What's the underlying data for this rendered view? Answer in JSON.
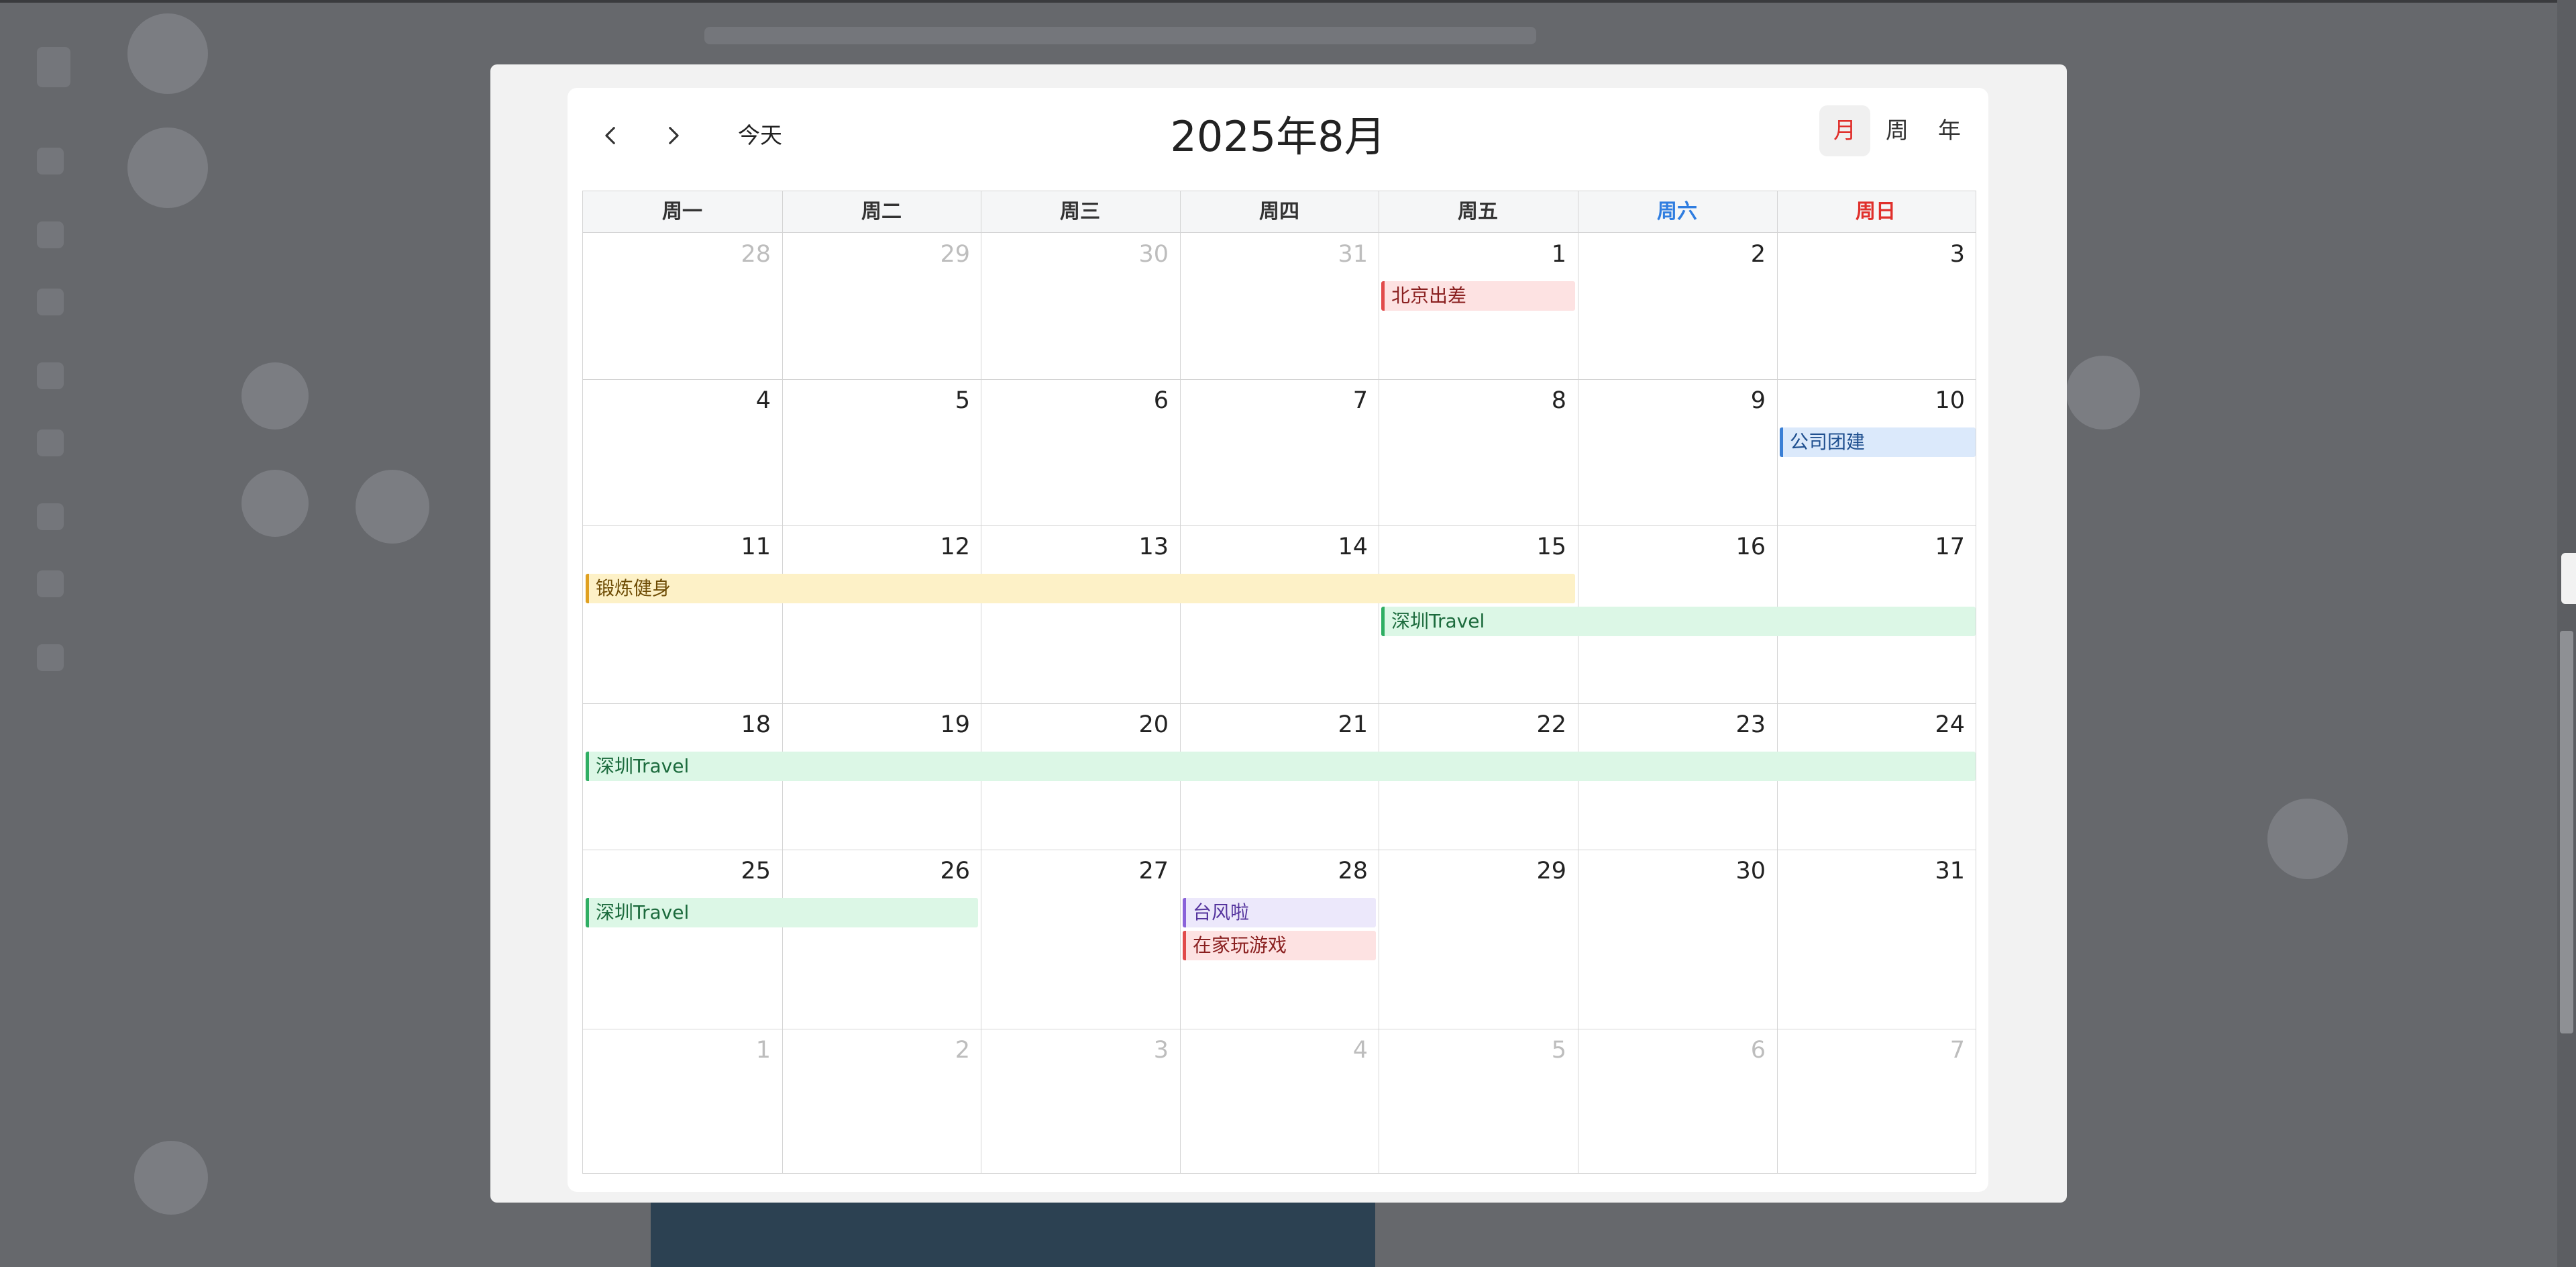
{
  "header": {
    "today_label": "今天",
    "title": "2025年8月",
    "views": [
      "月",
      "周",
      "年"
    ],
    "active_view": "月"
  },
  "weekdays": [
    "周一",
    "周二",
    "周三",
    "周四",
    "周五",
    "周六",
    "周日"
  ],
  "weeks": [
    [
      {
        "d": "28",
        "other": true
      },
      {
        "d": "29",
        "other": true
      },
      {
        "d": "30",
        "other": true
      },
      {
        "d": "31",
        "other": true
      },
      {
        "d": "1"
      },
      {
        "d": "2"
      },
      {
        "d": "3"
      }
    ],
    [
      {
        "d": "4"
      },
      {
        "d": "5"
      },
      {
        "d": "6"
      },
      {
        "d": "7"
      },
      {
        "d": "8"
      },
      {
        "d": "9"
      },
      {
        "d": "10"
      }
    ],
    [
      {
        "d": "11"
      },
      {
        "d": "12"
      },
      {
        "d": "13"
      },
      {
        "d": "14"
      },
      {
        "d": "15"
      },
      {
        "d": "16"
      },
      {
        "d": "17"
      }
    ],
    [
      {
        "d": "18"
      },
      {
        "d": "19"
      },
      {
        "d": "20"
      },
      {
        "d": "21"
      },
      {
        "d": "22"
      },
      {
        "d": "23"
      },
      {
        "d": "24"
      }
    ],
    [
      {
        "d": "25"
      },
      {
        "d": "26"
      },
      {
        "d": "27"
      },
      {
        "d": "28"
      },
      {
        "d": "29"
      },
      {
        "d": "30"
      },
      {
        "d": "31"
      }
    ],
    [
      {
        "d": "1",
        "other": true
      },
      {
        "d": "2",
        "other": true
      },
      {
        "d": "3",
        "other": true
      },
      {
        "d": "4",
        "other": true
      },
      {
        "d": "5",
        "other": true
      },
      {
        "d": "6",
        "other": true
      },
      {
        "d": "7",
        "other": true
      }
    ]
  ],
  "events": [
    {
      "title": "北京出差",
      "start": "2025-08-01",
      "end": "2025-08-01",
      "color": "red"
    },
    {
      "title": "公司团建",
      "start": "2025-08-10",
      "end": "2025-08-10",
      "color": "blue"
    },
    {
      "title": "锻炼健身",
      "start": "2025-08-11",
      "end": "2025-08-15",
      "color": "yellow"
    },
    {
      "title": "深圳Travel",
      "start": "2025-08-15",
      "end": "2025-08-26",
      "color": "green"
    },
    {
      "title": "台风啦",
      "start": "2025-08-28",
      "end": "2025-08-28",
      "color": "purple"
    },
    {
      "title": "在家玩游戏",
      "start": "2025-08-28",
      "end": "2025-08-28",
      "color": "red"
    }
  ],
  "colors": {
    "weekday_sat": "#2f7de0",
    "weekday_sun": "#e0302c",
    "active_view": "#e0302c",
    "event_palette": {
      "red": {
        "bg": "#fde2e2",
        "border": "#e14b4b",
        "text": "#8a2020"
      },
      "blue": {
        "bg": "#dbe9fb",
        "border": "#3a7fd5",
        "text": "#1f4f8f"
      },
      "yellow": {
        "bg": "#fdf1c7",
        "border": "#e0a020",
        "text": "#6e4c05"
      },
      "green": {
        "bg": "#dcf7e6",
        "border": "#2fae63",
        "text": "#1b6a3c"
      },
      "purple": {
        "bg": "#ece8fb",
        "border": "#8a63d9",
        "text": "#55349e"
      }
    }
  },
  "icons": {
    "prev": "chevron-left-icon",
    "next": "chevron-right-icon"
  }
}
